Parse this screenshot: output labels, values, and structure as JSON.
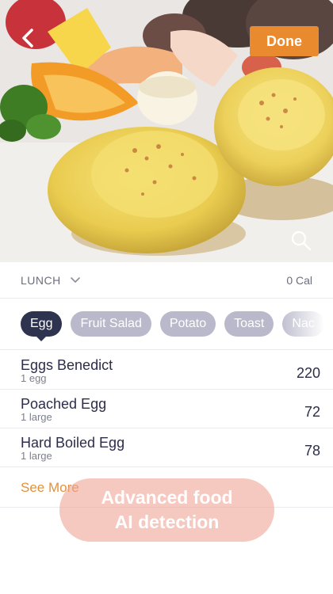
{
  "header": {
    "back_icon": "chevron-left-icon",
    "done_label": "Done",
    "zoom_icon": "search-icon",
    "accent_color": "#ea8a2f"
  },
  "meal": {
    "label": "LUNCH",
    "dropdown_icon": "chevron-down-icon",
    "calories": "0 Cal"
  },
  "chips": [
    {
      "label": "Egg",
      "active": true
    },
    {
      "label": "Fruit Salad",
      "active": false
    },
    {
      "label": "Potato",
      "active": false
    },
    {
      "label": "Toast",
      "active": false
    },
    {
      "label": "Nac",
      "active": false
    }
  ],
  "foods": [
    {
      "name": "Eggs Benedict",
      "serving": "1 egg",
      "calories": "220"
    },
    {
      "name": "Poached Egg",
      "serving": "1 large",
      "calories": "72"
    },
    {
      "name": "Hard Boiled Egg",
      "serving": "1 large",
      "calories": "78"
    }
  ],
  "see_more": "See More",
  "overlay": {
    "line1": "Advanced food",
    "line2": "AI detection"
  }
}
